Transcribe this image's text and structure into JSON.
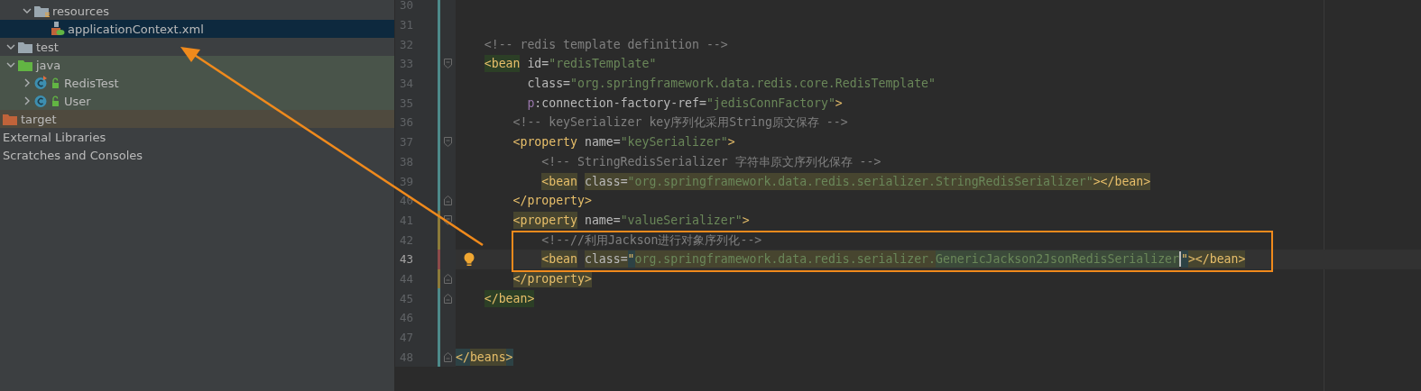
{
  "project_tree": {
    "cut_off_branch": [
      {
        "label": "resources",
        "kind": "resource-folder",
        "expanded": true,
        "selected": false,
        "children": [
          {
            "label": "applicationContext.xml",
            "kind": "xml-file",
            "selected": true
          }
        ]
      }
    ],
    "items": [
      {
        "label": "test",
        "kind": "folder",
        "expanded": true,
        "selected": false,
        "children": [
          {
            "label": "java",
            "kind": "test-folder",
            "expanded": true,
            "selected": false,
            "color": "#49544a",
            "children": [
              {
                "label": "RedisTest",
                "kind": "test-class",
                "expanded": false,
                "selected": false,
                "color": "#49544a"
              },
              {
                "label": "User",
                "kind": "class",
                "expanded": false,
                "selected": false,
                "color": "#49544a"
              }
            ]
          }
        ]
      },
      {
        "label": "target",
        "kind": "excluded-folder",
        "selected": false,
        "color": "#4f4a3e"
      },
      {
        "label": "External Libraries",
        "kind": "plain",
        "selected": false
      },
      {
        "label": "Scratches and Consoles",
        "kind": "plain",
        "selected": false
      }
    ]
  },
  "editor": {
    "lines": [
      {
        "number": "30",
        "kind": "plain",
        "color": "#4d8a8a",
        "current": false,
        "bulb": false
      },
      {
        "number": "31",
        "kind": "plain",
        "color": "#4d8a8a",
        "current": false,
        "bulb": false
      },
      {
        "number": "32",
        "kind": "plain",
        "color": "#4d8a8a",
        "current": false,
        "bulb": false,
        "tokens": [
          {
            "text": "    <!-- redis template definition -->",
            "kind": "comment"
          }
        ]
      },
      {
        "number": "33",
        "kind": "fold-start",
        "color": "#4d8a8a",
        "current": false,
        "bulb": false,
        "tokens": [
          {
            "text": "    <bean",
            "kind": "tag-match"
          },
          {
            "text": " id=",
            "kind": "attr"
          },
          {
            "text": "\"redisTemplate\"",
            "kind": "value"
          }
        ]
      },
      {
        "number": "34",
        "kind": "plain",
        "color": "#4d8a8a",
        "current": false,
        "bulb": false,
        "tokens": [
          {
            "text": "          class=",
            "kind": "attr"
          },
          {
            "text": "\"org.springframework.data.redis.core.RedisTemplate\"",
            "kind": "value"
          }
        ]
      },
      {
        "number": "35",
        "kind": "plain",
        "color": "#4d8a8a",
        "current": false,
        "bulb": false,
        "tokens": [
          {
            "text": "          p",
            "kind": "ns"
          },
          {
            "text": ":connection-factory-ref=",
            "kind": "attr"
          },
          {
            "text": "\"jedisConnFactory\"",
            "kind": "value"
          },
          {
            "text": ">",
            "kind": "tag"
          }
        ]
      },
      {
        "number": "36",
        "kind": "plain",
        "color": "#4d8a8a",
        "current": false,
        "bulb": false,
        "tokens": [
          {
            "text": "        <!-- keySerializer key序列化采用String原文保存 -->",
            "kind": "comment"
          }
        ]
      },
      {
        "number": "37",
        "kind": "fold-start",
        "color": "#4d8a8a",
        "current": false,
        "bulb": false,
        "tokens": [
          {
            "text": "        <property",
            "kind": "tag"
          },
          {
            "text": " name=",
            "kind": "attr"
          },
          {
            "text": "\"keySerializer\"",
            "kind": "value"
          },
          {
            "text": ">",
            "kind": "tag"
          }
        ]
      },
      {
        "number": "38",
        "kind": "plain",
        "color": "#4d8a8a",
        "current": false,
        "bulb": false,
        "tokens": [
          {
            "text": "            <!-- StringRedisSerializer 字符串原文序列化保存 -->",
            "kind": "comment"
          }
        ]
      },
      {
        "number": "39",
        "kind": "plain",
        "color": "#4d8a8a",
        "current": false,
        "bulb": false,
        "tokens": [
          {
            "text": "            <bean",
            "kind": "tag-olive"
          },
          {
            "text": " class=",
            "kind": "attr-olive"
          },
          {
            "text": "\"org.springframework.data.redis.serializer.StringRedisSerializer\"",
            "kind": "value-olive"
          },
          {
            "text": "></bean>",
            "kind": "tag-olive"
          }
        ]
      },
      {
        "number": "40",
        "kind": "fold-end",
        "color": "#4d8a8a",
        "current": false,
        "bulb": false,
        "tokens": [
          {
            "text": "        </property>",
            "kind": "tag"
          }
        ]
      },
      {
        "number": "41",
        "kind": "fold-start",
        "color": "#8c7b3a",
        "current": false,
        "bulb": false,
        "tokens": [
          {
            "text": "        <property",
            "kind": "tag-olive"
          },
          {
            "text": " name=",
            "kind": "attr"
          },
          {
            "text": "\"valueSerializer\"",
            "kind": "value"
          },
          {
            "text": ">",
            "kind": "tag"
          }
        ]
      },
      {
        "number": "42",
        "kind": "plain",
        "color": "#8c7b3a",
        "current": false,
        "bulb": false,
        "tokens": [
          {
            "text": "            <!--//利用Jackson进行对象序列化-->",
            "kind": "comment"
          }
        ]
      },
      {
        "number": "43",
        "kind": "plain",
        "color": "#8b4a4a",
        "current": true,
        "bulb": true,
        "tokens": [
          {
            "text": "            <bean",
            "kind": "tag-olive"
          },
          {
            "text": " class=",
            "kind": "attr-olive"
          },
          {
            "text": "\"",
            "kind": "tag-teal"
          },
          {
            "text": "org.springframework.data.redis.serializer.",
            "kind": "value-olive"
          },
          {
            "text": "GenericJackson2JsonRedisSerializer",
            "kind": "value-green"
          },
          {
            "kind": "caret"
          },
          {
            "text": "\"",
            "kind": "tag-teal"
          },
          {
            "text": "></bean>",
            "kind": "tag-olive"
          }
        ]
      },
      {
        "number": "44",
        "kind": "fold-end",
        "color": "#8c7b3a",
        "current": false,
        "bulb": false,
        "tokens": [
          {
            "text": "        </property>",
            "kind": "tag-olive"
          }
        ]
      },
      {
        "number": "45",
        "kind": "fold-end",
        "color": "#4d8a8a",
        "current": false,
        "bulb": false,
        "tokens": [
          {
            "text": "    </bean>",
            "kind": "tag-match"
          }
        ]
      },
      {
        "number": "46",
        "kind": "plain",
        "color": "#4d8a8a",
        "current": false,
        "bulb": false
      },
      {
        "number": "47",
        "kind": "plain",
        "color": "#4d8a8a",
        "current": false,
        "bulb": false
      },
      {
        "number": "48",
        "kind": "fold-end",
        "color": "#4d8a8a",
        "current": false,
        "bulb": false,
        "tokens": [
          {
            "text": "</",
            "kind": "tag-teal"
          },
          {
            "text": "beans",
            "kind": "tag-olive"
          },
          {
            "text": ">",
            "kind": "tag-teal"
          }
        ]
      }
    ]
  }
}
